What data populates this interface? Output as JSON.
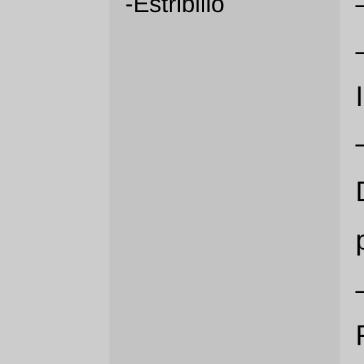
{
  "middle_column": {
    "text": "-Estribillo"
  },
  "right_column": {
    "lines": [
      "–",
      "–",
      "I",
      "–",
      "D",
      "p",
      "–",
      "F"
    ]
  }
}
